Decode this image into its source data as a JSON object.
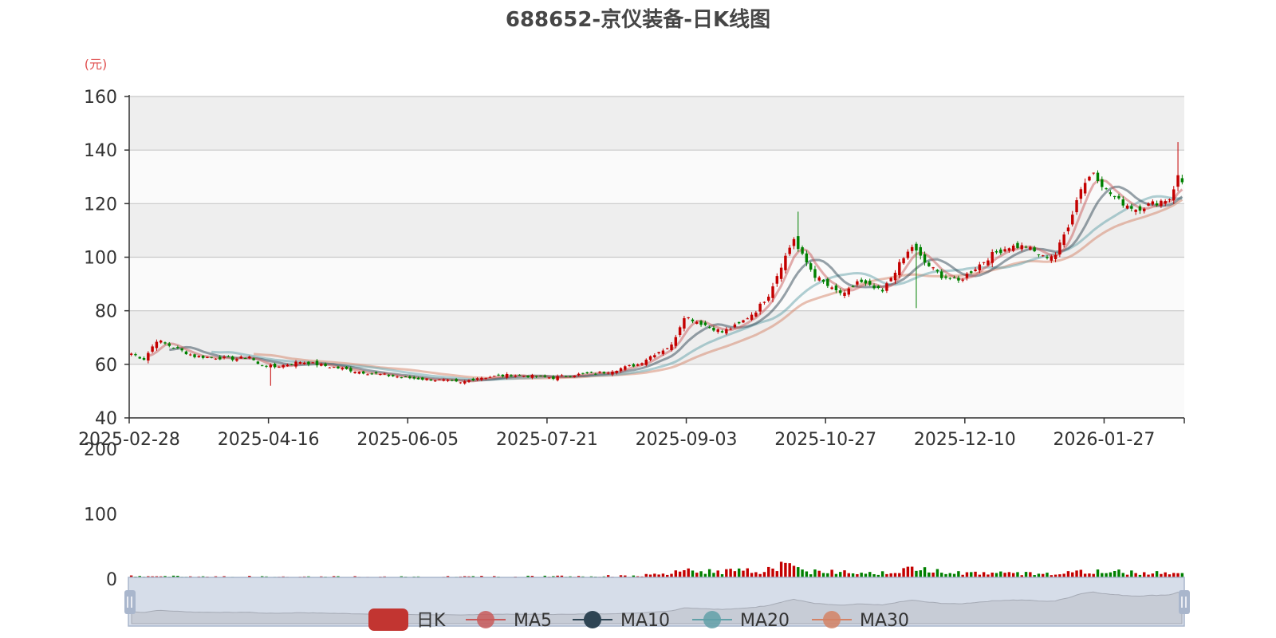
{
  "chart_data": {
    "type": "candlestick",
    "title": "688652-京仪装备-日K线图",
    "price_unit": "(元)",
    "price_axis": {
      "ylim": [
        40,
        160
      ],
      "ticks": [
        "40",
        "60",
        "80",
        "100",
        "120",
        "140",
        "160"
      ]
    },
    "volume_axis": {
      "ylim": [
        0,
        200
      ],
      "ticks": [
        "0",
        "100",
        "200"
      ]
    },
    "x_ticks": [
      "2025-02-28",
      "2025-04-16",
      "2025-06-05",
      "2025-07-21",
      "2025-09-03",
      "2025-10-27",
      "2025-12-10",
      "2026-01-27"
    ],
    "x_tick_positions": [
      0,
      33,
      66,
      99,
      132,
      165,
      198,
      231
    ],
    "n_days": 250,
    "close_anchors": [
      [
        0,
        64
      ],
      [
        3,
        62
      ],
      [
        6,
        69
      ],
      [
        15,
        63
      ],
      [
        25,
        62
      ],
      [
        28,
        63
      ],
      [
        30,
        60
      ],
      [
        34,
        59
      ],
      [
        40,
        61
      ],
      [
        55,
        57
      ],
      [
        65,
        55
      ],
      [
        74,
        54
      ],
      [
        78,
        53
      ],
      [
        82,
        55
      ],
      [
        90,
        56
      ],
      [
        100,
        55
      ],
      [
        104,
        56
      ],
      [
        112,
        57
      ],
      [
        120,
        60
      ],
      [
        124,
        64
      ],
      [
        128,
        67
      ],
      [
        131,
        78
      ],
      [
        140,
        72
      ],
      [
        144,
        75
      ],
      [
        148,
        80
      ],
      [
        151,
        86
      ],
      [
        154,
        97
      ],
      [
        157,
        107
      ],
      [
        158,
        103
      ],
      [
        162,
        93
      ],
      [
        166,
        88
      ],
      [
        169,
        86
      ],
      [
        172,
        91
      ],
      [
        175,
        89
      ],
      [
        178,
        87
      ],
      [
        181,
        95
      ],
      [
        185,
        104
      ],
      [
        188,
        98
      ],
      [
        192,
        93
      ],
      [
        196,
        91
      ],
      [
        200,
        96
      ],
      [
        204,
        101
      ],
      [
        208,
        104
      ],
      [
        212,
        104
      ],
      [
        216,
        100
      ],
      [
        219,
        101
      ],
      [
        222,
        112
      ],
      [
        225,
        126
      ],
      [
        228,
        132
      ],
      [
        231,
        125
      ],
      [
        234,
        121
      ],
      [
        238,
        118
      ],
      [
        242,
        120
      ],
      [
        246,
        122
      ],
      [
        248,
        130
      ],
      [
        249,
        128
      ]
    ],
    "volume_levels": [
      [
        0,
        4
      ],
      [
        60,
        3
      ],
      [
        110,
        4
      ],
      [
        125,
        6
      ],
      [
        131,
        12
      ],
      [
        150,
        12
      ],
      [
        154,
        22
      ],
      [
        160,
        12
      ],
      [
        180,
        10
      ],
      [
        186,
        16
      ],
      [
        200,
        9
      ],
      [
        215,
        8
      ],
      [
        225,
        11
      ],
      [
        249,
        10
      ]
    ],
    "series": [
      {
        "name": "日K",
        "color": "#c23531"
      },
      {
        "name": "MA5",
        "color": "#c85a5a",
        "period": 5
      },
      {
        "name": "MA10",
        "color": "#2f4554",
        "period": 10
      },
      {
        "name": "MA20",
        "color": "#61a0a8",
        "period": 20
      },
      {
        "name": "MA30",
        "color": "#d48265",
        "period": 30
      }
    ],
    "up_color": "#c40000",
    "down_color": "#008000"
  }
}
